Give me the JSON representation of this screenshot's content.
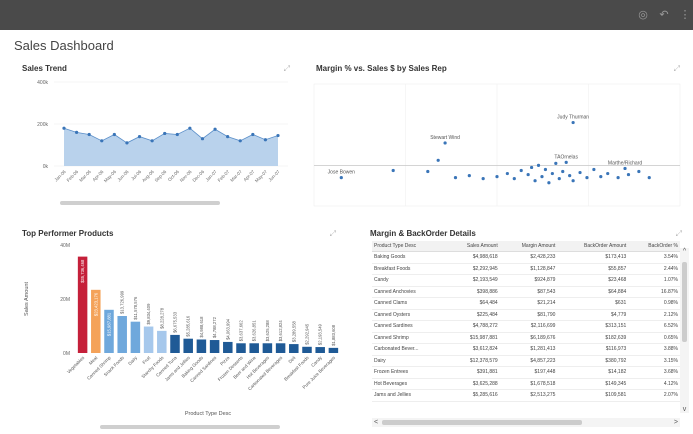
{
  "dashboard": {
    "title": "Sales Dashboard"
  },
  "icons": [
    "toolbar-icon-1",
    "toolbar-icon-2",
    "toolbar-icon-3"
  ],
  "panels": {
    "trend": {
      "title": "Sales Trend"
    },
    "scatter": {
      "title": "Margin % vs. Sales $ by Sales Rep"
    },
    "top": {
      "title": "Top Performer Products"
    },
    "table": {
      "title": "Margin & BackOrder Details"
    }
  },
  "chart_data": [
    {
      "type": "area",
      "title": "Sales Trend",
      "ylim": [
        0,
        400
      ],
      "ytick_labels": [
        "400k",
        "200k",
        "0k"
      ],
      "yticks": [
        400,
        200,
        0
      ],
      "categories": [
        "Jan-06",
        "Feb-06",
        "Mar-06",
        "Apr-06",
        "May-06",
        "Jun-06",
        "Jul-06",
        "Aug-06",
        "Sep-06",
        "Oct-06",
        "Nov-06",
        "Dec-06",
        "Jan-07",
        "Feb-07",
        "Mar-07",
        "Apr-07",
        "May-07",
        "Jun-07"
      ],
      "values": [
        180,
        160,
        150,
        120,
        150,
        110,
        140,
        120,
        155,
        150,
        180,
        130,
        175,
        140,
        120,
        150,
        125,
        145
      ]
    },
    {
      "type": "scatter",
      "title": "Margin % vs. Sales $ by Sales Rep",
      "annotations": [
        "Stewart Wind",
        "Judy Thurman",
        "Jose Bowen",
        "TAOrnelas",
        "Marthe/Richard"
      ],
      "points": [
        {
          "x": 0.05,
          "y": 0.18,
          "label": "Jose Bowen"
        },
        {
          "x": 0.35,
          "y": 0.52,
          "label": "Stewart Wind"
        },
        {
          "x": 0.72,
          "y": 0.72,
          "label": "Judy Thurman"
        },
        {
          "x": 0.7,
          "y": 0.33,
          "label": "TAOrnelas"
        },
        {
          "x": 0.87,
          "y": 0.27,
          "label": "Marthe/Richard"
        },
        {
          "x": 0.2,
          "y": 0.25
        },
        {
          "x": 0.3,
          "y": 0.24
        },
        {
          "x": 0.33,
          "y": 0.35
        },
        {
          "x": 0.38,
          "y": 0.18
        },
        {
          "x": 0.42,
          "y": 0.2
        },
        {
          "x": 0.46,
          "y": 0.17
        },
        {
          "x": 0.5,
          "y": 0.19
        },
        {
          "x": 0.53,
          "y": 0.22
        },
        {
          "x": 0.55,
          "y": 0.17
        },
        {
          "x": 0.57,
          "y": 0.25
        },
        {
          "x": 0.59,
          "y": 0.21
        },
        {
          "x": 0.6,
          "y": 0.28
        },
        {
          "x": 0.61,
          "y": 0.15
        },
        {
          "x": 0.62,
          "y": 0.3
        },
        {
          "x": 0.63,
          "y": 0.19
        },
        {
          "x": 0.64,
          "y": 0.26
        },
        {
          "x": 0.65,
          "y": 0.13
        },
        {
          "x": 0.66,
          "y": 0.22
        },
        {
          "x": 0.67,
          "y": 0.32
        },
        {
          "x": 0.68,
          "y": 0.17
        },
        {
          "x": 0.69,
          "y": 0.24
        },
        {
          "x": 0.71,
          "y": 0.2
        },
        {
          "x": 0.72,
          "y": 0.15
        },
        {
          "x": 0.74,
          "y": 0.23
        },
        {
          "x": 0.76,
          "y": 0.18
        },
        {
          "x": 0.78,
          "y": 0.26
        },
        {
          "x": 0.8,
          "y": 0.19
        },
        {
          "x": 0.82,
          "y": 0.22
        },
        {
          "x": 0.85,
          "y": 0.18
        },
        {
          "x": 0.88,
          "y": 0.21
        },
        {
          "x": 0.91,
          "y": 0.24
        },
        {
          "x": 0.94,
          "y": 0.18
        }
      ]
    },
    {
      "type": "bar",
      "title": "Top Performer Products",
      "xlabel": "Product Type Desc",
      "ylabel": "Sales Amount",
      "ylim": [
        0,
        40
      ],
      "ytick_labels": [
        "40M",
        "20M",
        "0M"
      ],
      "yticks": [
        40,
        20,
        0
      ],
      "categories": [
        "Vegetables",
        "Meat",
        "Canned Shrimp",
        "Snack Foods",
        "Dairy",
        "Fruit",
        "Starchy Foods",
        "Canned Tuna",
        "Jams and Jellies",
        "Baking Goods",
        "Canned Sardines",
        "Pizza",
        "Frozen Desserts",
        "Beer and Wine",
        "Hot Beverages",
        "Carbonated Beverages",
        "Deli",
        "Breakfast Foods",
        "Candy",
        "Pure Juice Beverages"
      ],
      "value_labels": [
        "$35,736,468",
        "$23,423,176",
        "$15,987,881",
        "$13,726,999",
        "$11,578,576",
        "$9,834,409",
        "$8,228,278",
        "$6,675,533",
        "$5,285,616",
        "$4,988,618",
        "$4,788,272",
        "$4,063,994",
        "$3,637,662",
        "$3,626,851",
        "$3,625,288",
        "$3,612,824",
        "$3,289,558",
        "$2,292,945",
        "$2,193,549",
        "$1,883,608"
      ],
      "values": [
        35.7,
        23.4,
        16.0,
        13.7,
        11.6,
        9.8,
        8.2,
        6.7,
        5.3,
        5.0,
        4.8,
        4.1,
        3.6,
        3.6,
        3.6,
        3.6,
        3.3,
        2.3,
        2.2,
        1.9
      ],
      "colors": [
        "#c5203a",
        "#f4a259",
        "#6fa8dc",
        "#6fa8dc",
        "#6fa8dc",
        "#a6c8ec",
        "#a6c8ec",
        "#1f5a96",
        "#1f5a96",
        "#1f5a96",
        "#1f5a96",
        "#1f5a96",
        "#1f5a96",
        "#1f5a96",
        "#1f5a96",
        "#1f5a96",
        "#1f5a96",
        "#1f5a96",
        "#1f5a96",
        "#1f5a96"
      ]
    }
  ],
  "table": {
    "columns": [
      "Product Type Desc",
      "Sales Amount",
      "Margin Amount",
      "BackOrder Amount",
      "BackOrder %"
    ],
    "rows": [
      [
        "Baking Goods",
        "$4,988,618",
        "$2,428,233",
        "$173,413",
        "3.54%"
      ],
      [
        "Breakfast Foods",
        "$2,292,945",
        "$1,128,847",
        "$55,857",
        "2.44%"
      ],
      [
        "Candy",
        "$2,193,549",
        "$924,879",
        "$23,468",
        "1.07%"
      ],
      [
        "Canned Anchovies",
        "$398,886",
        "$87,543",
        "$64,884",
        "16.87%"
      ],
      [
        "Canned Clams",
        "$64,484",
        "$21,214",
        "$631",
        "0.98%"
      ],
      [
        "Canned Oysters",
        "$225,484",
        "$81,790",
        "$4,779",
        "2.12%"
      ],
      [
        "Canned Sardines",
        "$4,788,272",
        "$2,116,699",
        "$313,151",
        "6.52%"
      ],
      [
        "Canned Shrimp",
        "$15,987,881",
        "$6,189,676",
        "$182,639",
        "0.65%"
      ],
      [
        "Carbonated Bever...",
        "$3,612,824",
        "$1,281,413",
        "$116,973",
        "3.88%"
      ],
      [
        "Dairy",
        "$12,378,579",
        "$4,857,223",
        "$380,792",
        "3.15%"
      ],
      [
        "Frozen Entrees",
        "$391,881",
        "$197,448",
        "$14,182",
        "3.68%"
      ],
      [
        "Hot Beverages",
        "$3,625,288",
        "$1,678,518",
        "$149,345",
        "4.12%"
      ],
      [
        "Jams and Jellies",
        "$5,285,616",
        "$2,513,275",
        "$109,581",
        "2.07%"
      ]
    ]
  }
}
